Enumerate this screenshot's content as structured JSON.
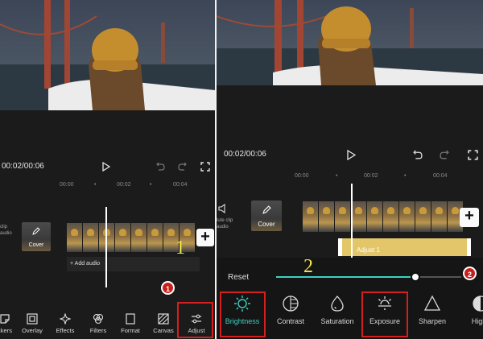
{
  "left": {
    "time": "00:02/00:06",
    "ruler": [
      "00:00",
      "00:02",
      "00:04"
    ],
    "side_label": "clip\naudio",
    "cover_label": "Cover",
    "add_audio_label": "+ Add audio",
    "tabs": [
      {
        "label": "ckers",
        "icon": "sticker-icon"
      },
      {
        "label": "Overlay",
        "icon": "overlay-icon"
      },
      {
        "label": "Effects",
        "icon": "effects-icon"
      },
      {
        "label": "Filters",
        "icon": "filters-icon"
      },
      {
        "label": "Format",
        "icon": "format-icon"
      },
      {
        "label": "Canvas",
        "icon": "canvas-icon"
      },
      {
        "label": "Adjust",
        "icon": "adjust-icon"
      }
    ],
    "badge": "1",
    "step_number": "1"
  },
  "right": {
    "time": "00:02/00:06",
    "ruler": [
      "00:00",
      "00:02",
      "00:04"
    ],
    "side_label": "lute clip\naudio",
    "cover_label": "Cover",
    "adjust_clip_label": "Adjust 1",
    "reset_label": "Reset",
    "slider_value_percent": 75,
    "badge": "2",
    "step_number": "2",
    "tools": [
      {
        "label": "Brightness",
        "icon": "brightness-icon",
        "active": true
      },
      {
        "label": "Contrast",
        "icon": "contrast-icon",
        "active": false
      },
      {
        "label": "Saturation",
        "icon": "saturation-icon",
        "active": false
      },
      {
        "label": "Exposure",
        "icon": "exposure-icon",
        "active": false
      },
      {
        "label": "Sharpen",
        "icon": "sharpen-icon",
        "active": false
      },
      {
        "label": "Highli",
        "icon": "highlight-icon",
        "active": false
      }
    ]
  },
  "colors": {
    "accent_teal": "#3fd0c0",
    "highlight_red": "#d41f1f",
    "step_yellow": "#f2e64b",
    "adjust_track": "#e3c66a"
  }
}
